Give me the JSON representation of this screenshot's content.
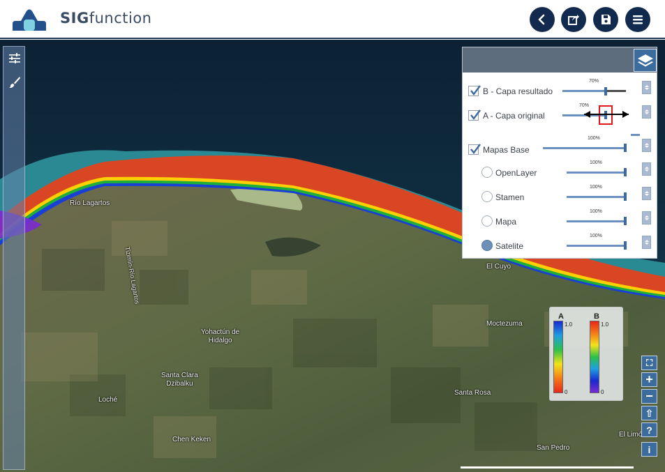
{
  "app": {
    "brand_bold": "SIG",
    "brand_rest": "function"
  },
  "header_buttons": [
    {
      "name": "back-button",
      "icon": "chevron-left-icon"
    },
    {
      "name": "share-button",
      "icon": "share-icon"
    },
    {
      "name": "save-button",
      "icon": "save-icon"
    },
    {
      "name": "menu-button",
      "icon": "hamburger-icon"
    }
  ],
  "left_tools": [
    {
      "name": "settings-sliders-button",
      "icon": "sliders-icon"
    },
    {
      "name": "brush-button",
      "icon": "brush-icon"
    }
  ],
  "layers": {
    "items": [
      {
        "label": "B - Capa resultado",
        "kind": "checkbox",
        "checked": true,
        "opacity": "70%"
      },
      {
        "label": "A - Capa original",
        "kind": "checkbox",
        "checked": true,
        "opacity": "70%"
      },
      {
        "label": "Mapas Base",
        "kind": "checkbox",
        "checked": true,
        "opacity": "100%"
      },
      {
        "label": "OpenLayer",
        "kind": "radio",
        "checked": false,
        "opacity": "100%"
      },
      {
        "label": "Stamen",
        "kind": "radio",
        "checked": false,
        "opacity": "100%"
      },
      {
        "label": "Mapa",
        "kind": "radio",
        "checked": false,
        "opacity": "100%"
      },
      {
        "label": "Satelite",
        "kind": "radio",
        "checked": true,
        "opacity": "100%"
      }
    ]
  },
  "legend": {
    "a_title": "A",
    "a_max": "1.0",
    "a_min": "0",
    "b_title": "B",
    "b_max": "1.0",
    "b_min": "0"
  },
  "places": {
    "rio_lagartos": "Río Lagartos",
    "road": "Tizimín-Río Lagartos",
    "el_cuyo": "El Cuyo",
    "yohactun": "Yohactún de\nHidalgo",
    "moctezuma": "Moctezuma",
    "santa_clara": "Santa Clara\nDzibalku",
    "santa_rosa": "Santa Rosa",
    "loche": "Loché",
    "chen_keken": "Chen Keken",
    "san_pedro": "San Pedro",
    "el_limon": "El Limón"
  },
  "map_controls": [
    {
      "name": "fullscreen-button",
      "label": "⛶"
    },
    {
      "name": "zoom-in-button",
      "label": "+"
    },
    {
      "name": "zoom-out-button",
      "label": "−"
    },
    {
      "name": "north-button",
      "label": "⇧"
    },
    {
      "name": "help-button",
      "label": "?"
    },
    {
      "name": "info-button",
      "label": "i"
    }
  ]
}
